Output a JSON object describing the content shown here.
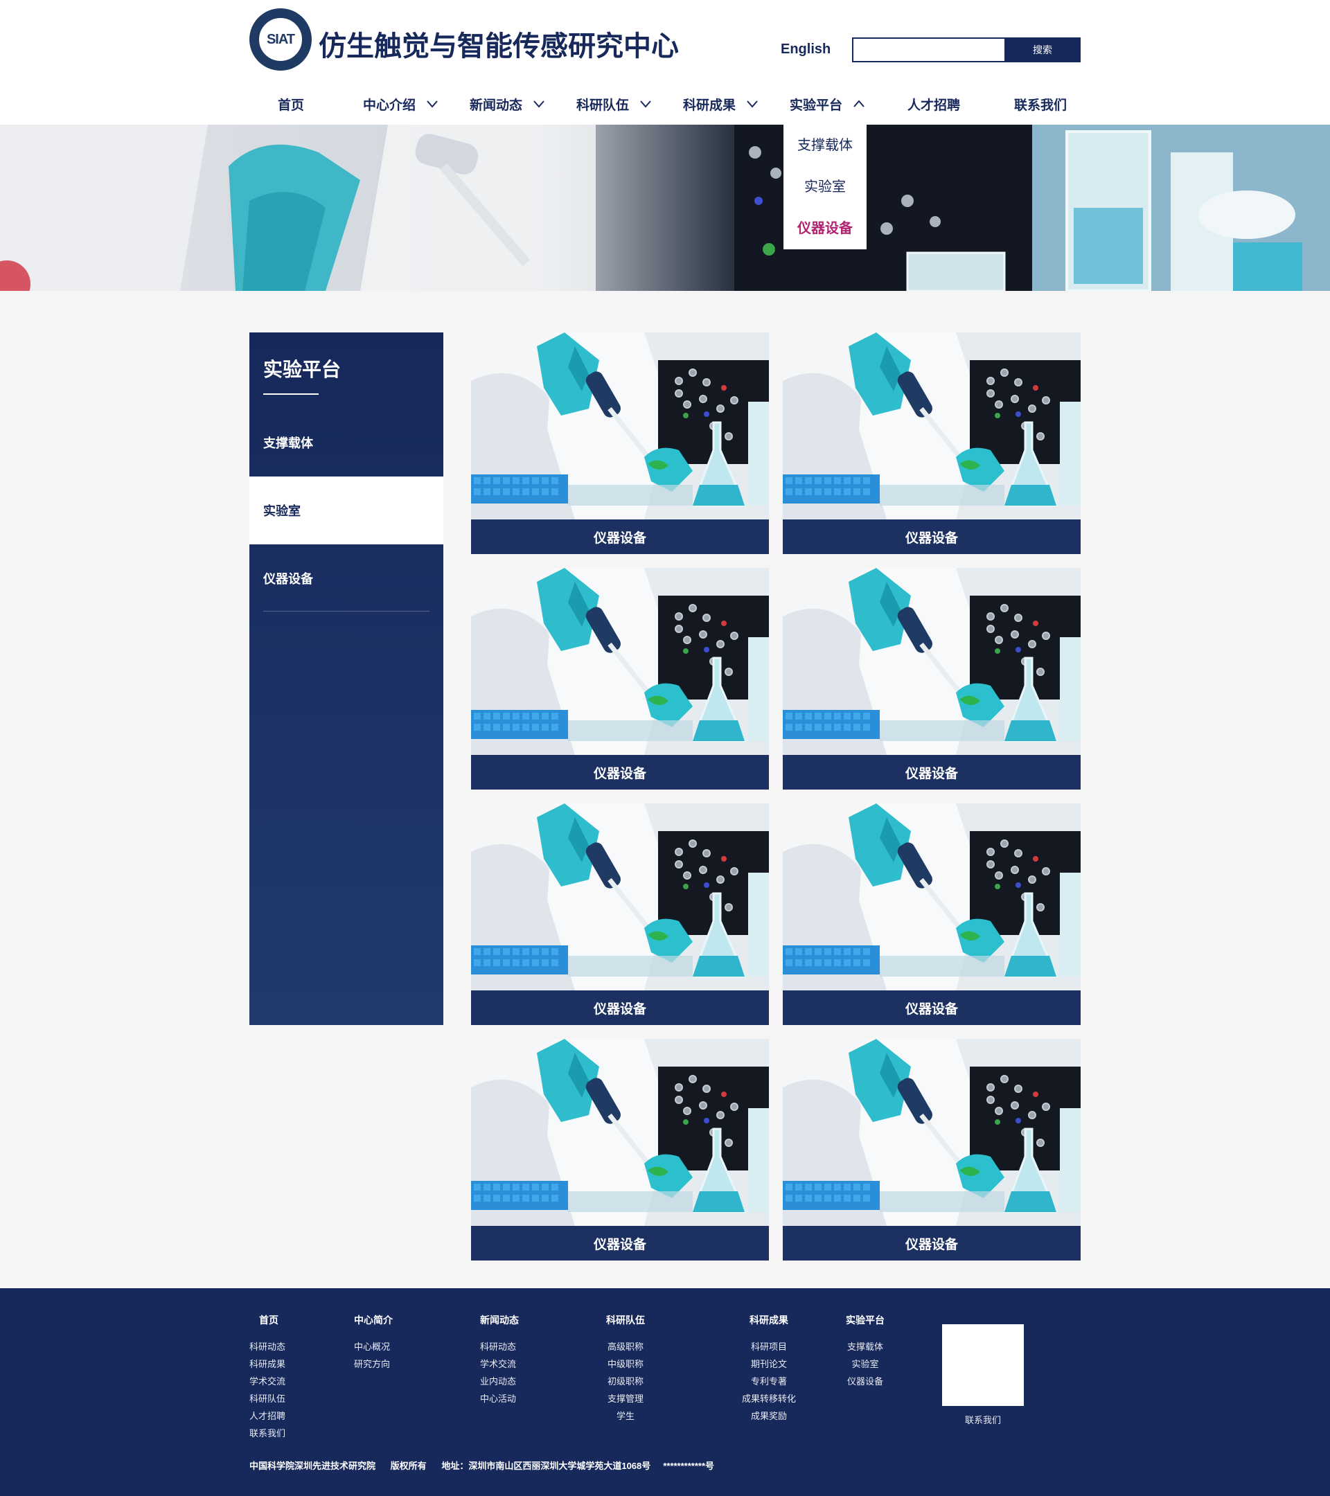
{
  "header": {
    "logo_text": "SIAT",
    "title": "仿生触觉与智能传感研究中心",
    "lang_link": "English",
    "search": {
      "value": "",
      "placeholder": "",
      "button_label": "搜索"
    }
  },
  "nav": {
    "items": [
      {
        "label": "首页"
      },
      {
        "label": "中心介绍"
      },
      {
        "label": "新闻动态"
      },
      {
        "label": "科研队伍"
      },
      {
        "label": "科研成果"
      },
      {
        "label": "实验平台"
      },
      {
        "label": "人才招聘"
      },
      {
        "label": "联系我们"
      }
    ],
    "dropdown": [
      "支撑载体",
      "实验室",
      "仪器设备"
    ]
  },
  "sidebar": {
    "title": "实验平台",
    "items": [
      {
        "label": "支撑载体"
      },
      {
        "label": "实验室"
      },
      {
        "label": "仪器设备"
      }
    ]
  },
  "cards": [
    {
      "caption": "仪器设备"
    },
    {
      "caption": "仪器设备"
    },
    {
      "caption": "仪器设备"
    },
    {
      "caption": "仪器设备"
    },
    {
      "caption": "仪器设备"
    },
    {
      "caption": "仪器设备"
    },
    {
      "caption": "仪器设备"
    },
    {
      "caption": "仪器设备"
    }
  ],
  "footer": {
    "columns": [
      {
        "title": "首页",
        "links": [
          "科研动态",
          "科研成果",
          "学术交流",
          "科研队伍",
          "人才招聘",
          "联系我们"
        ]
      },
      {
        "title": "中心简介",
        "links": [
          "中心概况",
          "研究方向"
        ]
      },
      {
        "title": "新闻动态",
        "links": [
          "科研动态",
          "学术交流",
          "业内动态",
          "中心活动"
        ]
      },
      {
        "title": "科研队伍",
        "links": [
          "高级职称",
          "中级职称",
          "初级职称",
          "支撑管理",
          "学生"
        ]
      },
      {
        "title": "科研成果",
        "links": [
          "科研项目",
          "期刊论文",
          "专利专著",
          "成果转移转化",
          "成果奖励"
        ]
      },
      {
        "title": "实验平台",
        "links": [
          "支撑载体",
          "实验室",
          "仪器设备"
        ]
      }
    ],
    "qr_label": "联系我们",
    "copyright": "中国科学院深圳先进技术研究院      版权所有      地址：深圳市南山区西丽深圳大学城学苑大道1068号     ************号"
  },
  "colors": {
    "brand_navy": "#17285a",
    "dropdown_active": "#b0236f",
    "caption_bar": "#1c3062",
    "page_bg": "#f5f5f5"
  },
  "icons": {
    "nav_expand": "chevron-down-icon",
    "nav_collapse": "chevron-up-icon"
  }
}
